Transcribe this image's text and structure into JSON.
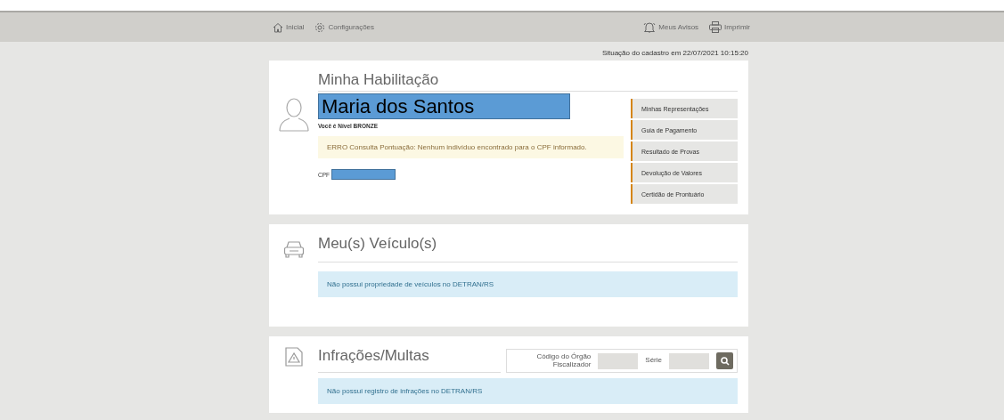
{
  "nav": {
    "left": [
      {
        "label": "Inicial"
      },
      {
        "label": "Configurações"
      }
    ],
    "right": [
      {
        "label": "Meus Avisos"
      },
      {
        "label": "Imprimir"
      }
    ]
  },
  "status": "Situação do cadastro em 22/07/2021 10:15:20",
  "license": {
    "title": "Minha Habilitação",
    "name": "Maria dos Santos",
    "level": "Você é Nível BRONZE",
    "error": "ERRO Consulta Pontuação: Nenhum indivíduo encontrado para o CPF informado.",
    "cpf_label": "CPF",
    "menu": [
      "Minhas Representações",
      "Guia de Pagamento",
      "Resultado de Provas",
      "Devolução de Valores",
      "Certidão de Prontuário"
    ]
  },
  "vehicles": {
    "title": "Meu(s) Veículo(s)",
    "message": "Não possui propriedade de veículos no DETRAN/RS"
  },
  "infractions": {
    "title": "Infrações/Multas",
    "message": "Não possui registro de infrações no DETRAN/RS",
    "filters": [
      {
        "label": "Código do Órgão Fiscalizador"
      },
      {
        "label": "Série"
      }
    ]
  }
}
